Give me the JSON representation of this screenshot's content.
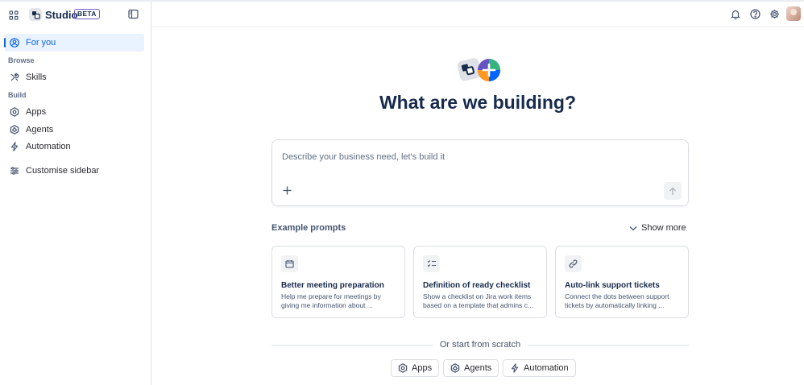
{
  "sidebar": {
    "app_name": "Studio",
    "badge": "BETA",
    "nav": {
      "for_you": "For you",
      "browse_label": "Browse",
      "skills": "Skills",
      "build_label": "Build",
      "apps": "Apps",
      "agents": "Agents",
      "automation": "Automation",
      "customise": "Customise sidebar"
    }
  },
  "main": {
    "headline": "What are we building?",
    "prompt": {
      "placeholder": "Describe your business need, let's build it"
    },
    "examples_title": "Example prompts",
    "show_more": "Show more",
    "cards": [
      {
        "icon": "calendar-icon",
        "title": "Better meeting preparation",
        "desc": "Help me prepare for meetings by giving me information about ..."
      },
      {
        "icon": "checklist-icon",
        "title": "Definition of ready checklist",
        "desc": "Show a checklist on Jira work items based on a template that admins c..."
      },
      {
        "icon": "link-icon",
        "title": "Auto-link support tickets",
        "desc": "Connect the dots between support tickets by automatically linking ..."
      }
    ],
    "scratch_label": "Or start from scratch",
    "scratch_buttons": {
      "apps": "Apps",
      "agents": "Agents",
      "automation": "Automation"
    }
  },
  "colors": {
    "accent": "#0c66e4",
    "active_bg": "#e9f2ff",
    "text": "#172b4d"
  }
}
